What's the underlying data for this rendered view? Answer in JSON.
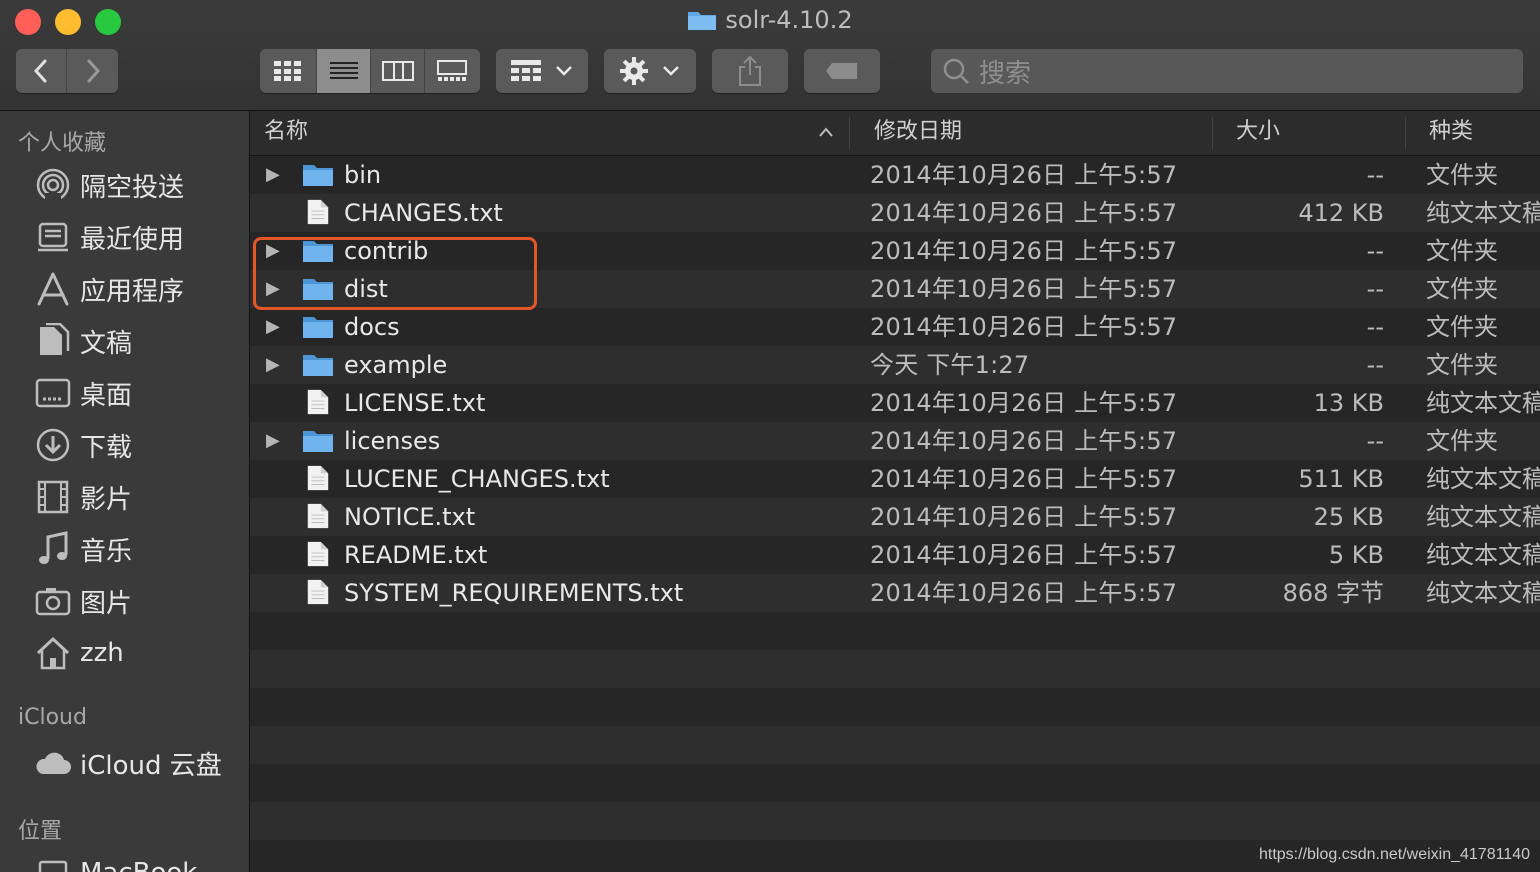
{
  "window": {
    "title": "solr-4.10.2"
  },
  "toolbar": {
    "search_placeholder": "搜索"
  },
  "sidebar": {
    "favorites_header": "个人收藏",
    "favorites": [
      {
        "label": "隔空投送",
        "icon": "airdrop-icon"
      },
      {
        "label": "最近使用",
        "icon": "recents-icon"
      },
      {
        "label": "应用程序",
        "icon": "applications-icon"
      },
      {
        "label": "文稿",
        "icon": "documents-icon"
      },
      {
        "label": "桌面",
        "icon": "desktop-icon"
      },
      {
        "label": "下载",
        "icon": "downloads-icon"
      },
      {
        "label": "影片",
        "icon": "movies-icon"
      },
      {
        "label": "音乐",
        "icon": "music-icon"
      },
      {
        "label": "图片",
        "icon": "pictures-icon"
      },
      {
        "label": "zzh",
        "icon": "home-icon"
      }
    ],
    "icloud_header": "iCloud",
    "icloud": [
      {
        "label": "iCloud 云盘",
        "icon": "cloud-icon"
      }
    ],
    "locations_header": "位置",
    "locations": [
      {
        "label": "MacBook",
        "icon": "laptop-icon"
      }
    ]
  },
  "columns": {
    "name": "名称",
    "date": "修改日期",
    "size": "大小",
    "kind": "种类"
  },
  "files": [
    {
      "name": "bin",
      "type": "folder",
      "date": "2014年10月26日 上午5:57",
      "size": "--",
      "kind": "文件夹"
    },
    {
      "name": "CHANGES.txt",
      "type": "file",
      "date": "2014年10月26日 上午5:57",
      "size": "412 KB",
      "kind": "纯文本文稿"
    },
    {
      "name": "contrib",
      "type": "folder",
      "date": "2014年10月26日 上午5:57",
      "size": "--",
      "kind": "文件夹"
    },
    {
      "name": "dist",
      "type": "folder",
      "date": "2014年10月26日 上午5:57",
      "size": "--",
      "kind": "文件夹"
    },
    {
      "name": "docs",
      "type": "folder",
      "date": "2014年10月26日 上午5:57",
      "size": "--",
      "kind": "文件夹"
    },
    {
      "name": "example",
      "type": "folder",
      "date": "今天 下午1:27",
      "size": "--",
      "kind": "文件夹"
    },
    {
      "name": "LICENSE.txt",
      "type": "file",
      "date": "2014年10月26日 上午5:57",
      "size": "13 KB",
      "kind": "纯文本文稿"
    },
    {
      "name": "licenses",
      "type": "folder",
      "date": "2014年10月26日 上午5:57",
      "size": "--",
      "kind": "文件夹"
    },
    {
      "name": "LUCENE_CHANGES.txt",
      "type": "file",
      "date": "2014年10月26日 上午5:57",
      "size": "511 KB",
      "kind": "纯文本文稿"
    },
    {
      "name": "NOTICE.txt",
      "type": "file",
      "date": "2014年10月26日 上午5:57",
      "size": "25 KB",
      "kind": "纯文本文稿"
    },
    {
      "name": "README.txt",
      "type": "file",
      "date": "2014年10月26日 上午5:57",
      "size": "5 KB",
      "kind": "纯文本文稿"
    },
    {
      "name": "SYSTEM_REQUIREMENTS.txt",
      "type": "file",
      "date": "2014年10月26日 上午5:57",
      "size": "868 字节",
      "kind": "纯文本文稿"
    }
  ],
  "watermark": "https://blog.csdn.net/weixin_41781140",
  "colors": {
    "highlight": "#e2562a",
    "folder": "#5fa8e8"
  }
}
